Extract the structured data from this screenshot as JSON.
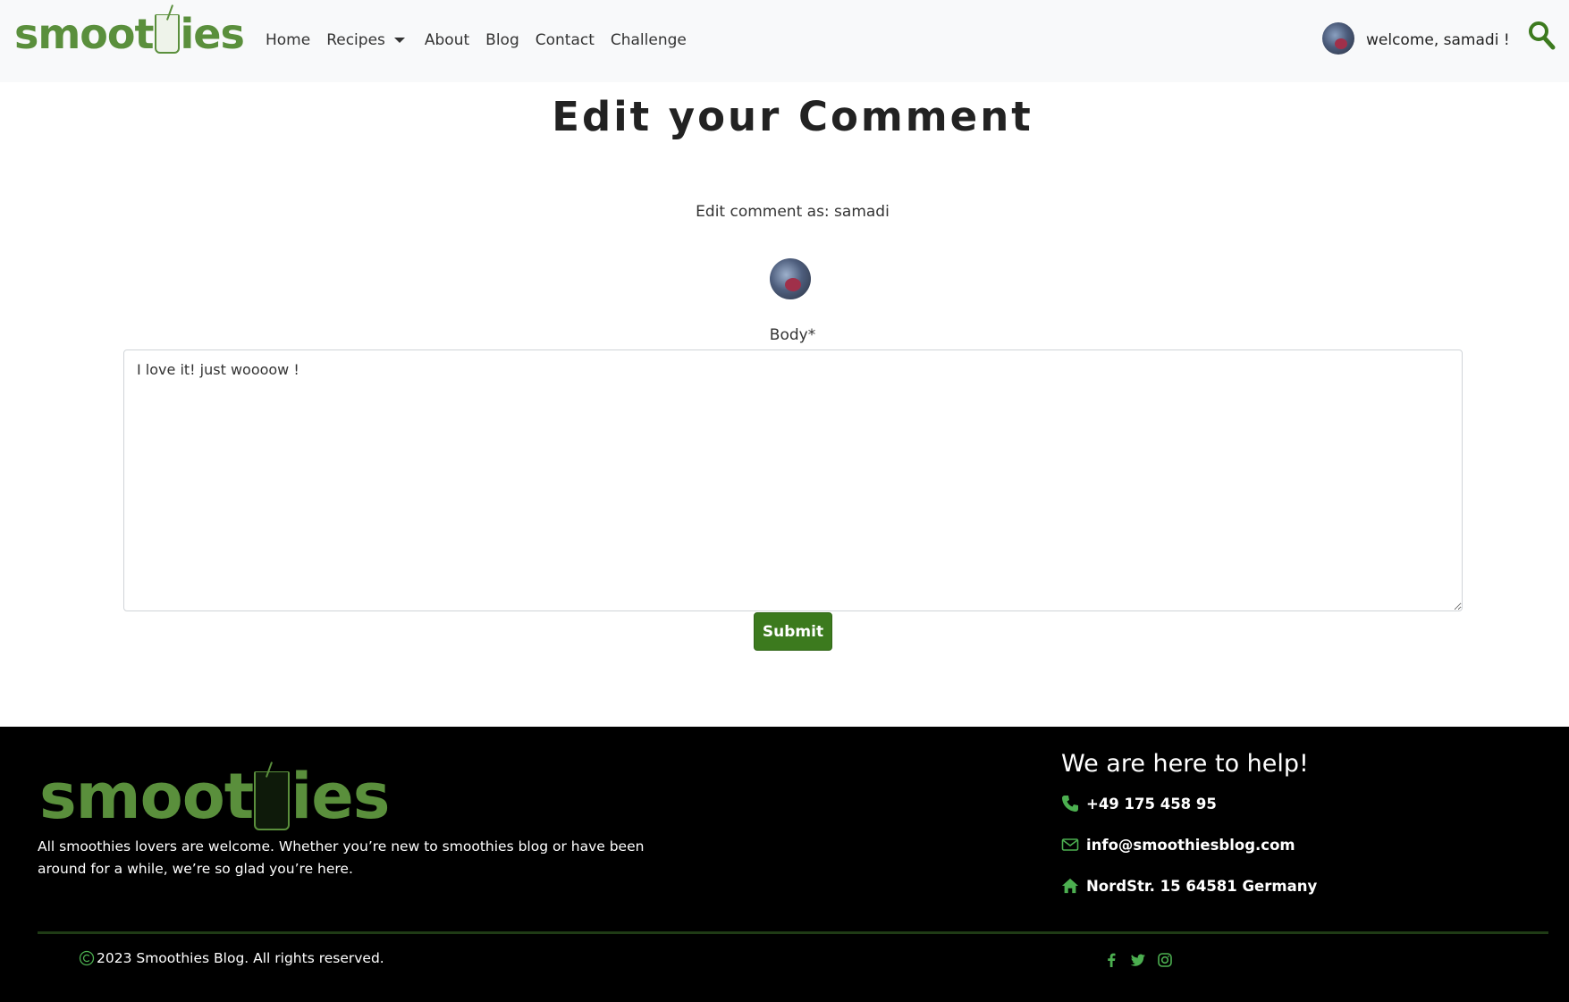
{
  "brand": {
    "logo_pre": "smoot",
    "logo_post": "ies"
  },
  "nav": {
    "items": [
      {
        "label": "Home"
      },
      {
        "label": "Recipes"
      },
      {
        "label": "About"
      },
      {
        "label": "Blog"
      },
      {
        "label": "Contact"
      },
      {
        "label": "Challenge"
      }
    ],
    "welcome": "welcome, samadi !"
  },
  "main": {
    "title": "Edit your Comment",
    "edit_as": "Edit comment as: samadi",
    "body_label": "Body*",
    "body_value": "I love it! just woooow !",
    "submit_label": "Submit"
  },
  "footer": {
    "about": "All smoothies lovers are welcome. Whether you’re new to smoothies blog or have been around for a while, we’re so glad you’re here.",
    "help_title": "We are here to help!",
    "phone": "+49 175 458 95",
    "email": "info@smoothiesblog.com",
    "address": "NordStr. 15 64581 Germany",
    "copyright": "2023 Smoothies Blog. All rights reserved."
  },
  "colors": {
    "brand_green": "#5a8f3c",
    "button_green": "#3c7a1e",
    "navbar_bg": "#f8f9fa",
    "footer_bg": "#000000"
  },
  "icons": [
    "search-icon",
    "phone-icon",
    "envelope-icon",
    "home-icon",
    "copyright-icon",
    "facebook-icon",
    "twitter-icon",
    "instagram-icon"
  ]
}
